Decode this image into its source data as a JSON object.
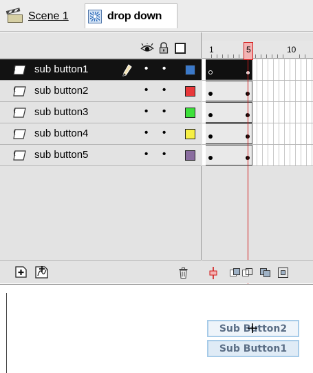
{
  "breadcrumb": {
    "scene_label": "Scene 1",
    "symbol_label": "drop down",
    "scene_icon": "clapperboard-icon",
    "symbol_icon": "movieclip-icon"
  },
  "timeline": {
    "header_icons": [
      "eye-icon",
      "lock-icon",
      "outline-icon"
    ],
    "ruler": {
      "labels": [
        "1",
        "10"
      ],
      "current_frame": "5"
    },
    "layers": [
      {
        "name": "sub button1",
        "color": "#3b79c9",
        "selected": true
      },
      {
        "name": "sub button2",
        "color": "#e8383a",
        "selected": false
      },
      {
        "name": "sub button3",
        "color": "#3de03a",
        "selected": false
      },
      {
        "name": "sub button4",
        "color": "#f6ef45",
        "selected": false
      },
      {
        "name": "sub button5",
        "color": "#8a6d9f",
        "selected": false
      }
    ],
    "footer_icons": [
      "add-layer-icon",
      "add-motion-guide-icon",
      "trash-icon"
    ],
    "frame_footer_icons": [
      "center-frame-icon",
      "onion-skin-icon",
      "onion-skin-outlines-icon",
      "edit-multiple-frames-icon",
      "modify-onion-markers-icon"
    ]
  },
  "stage": {
    "button_top": "Sub Button2",
    "button_bottom": "Sub Button1",
    "button_border_color": "#a7cbe8",
    "button_text_color": "#5b6e86"
  }
}
